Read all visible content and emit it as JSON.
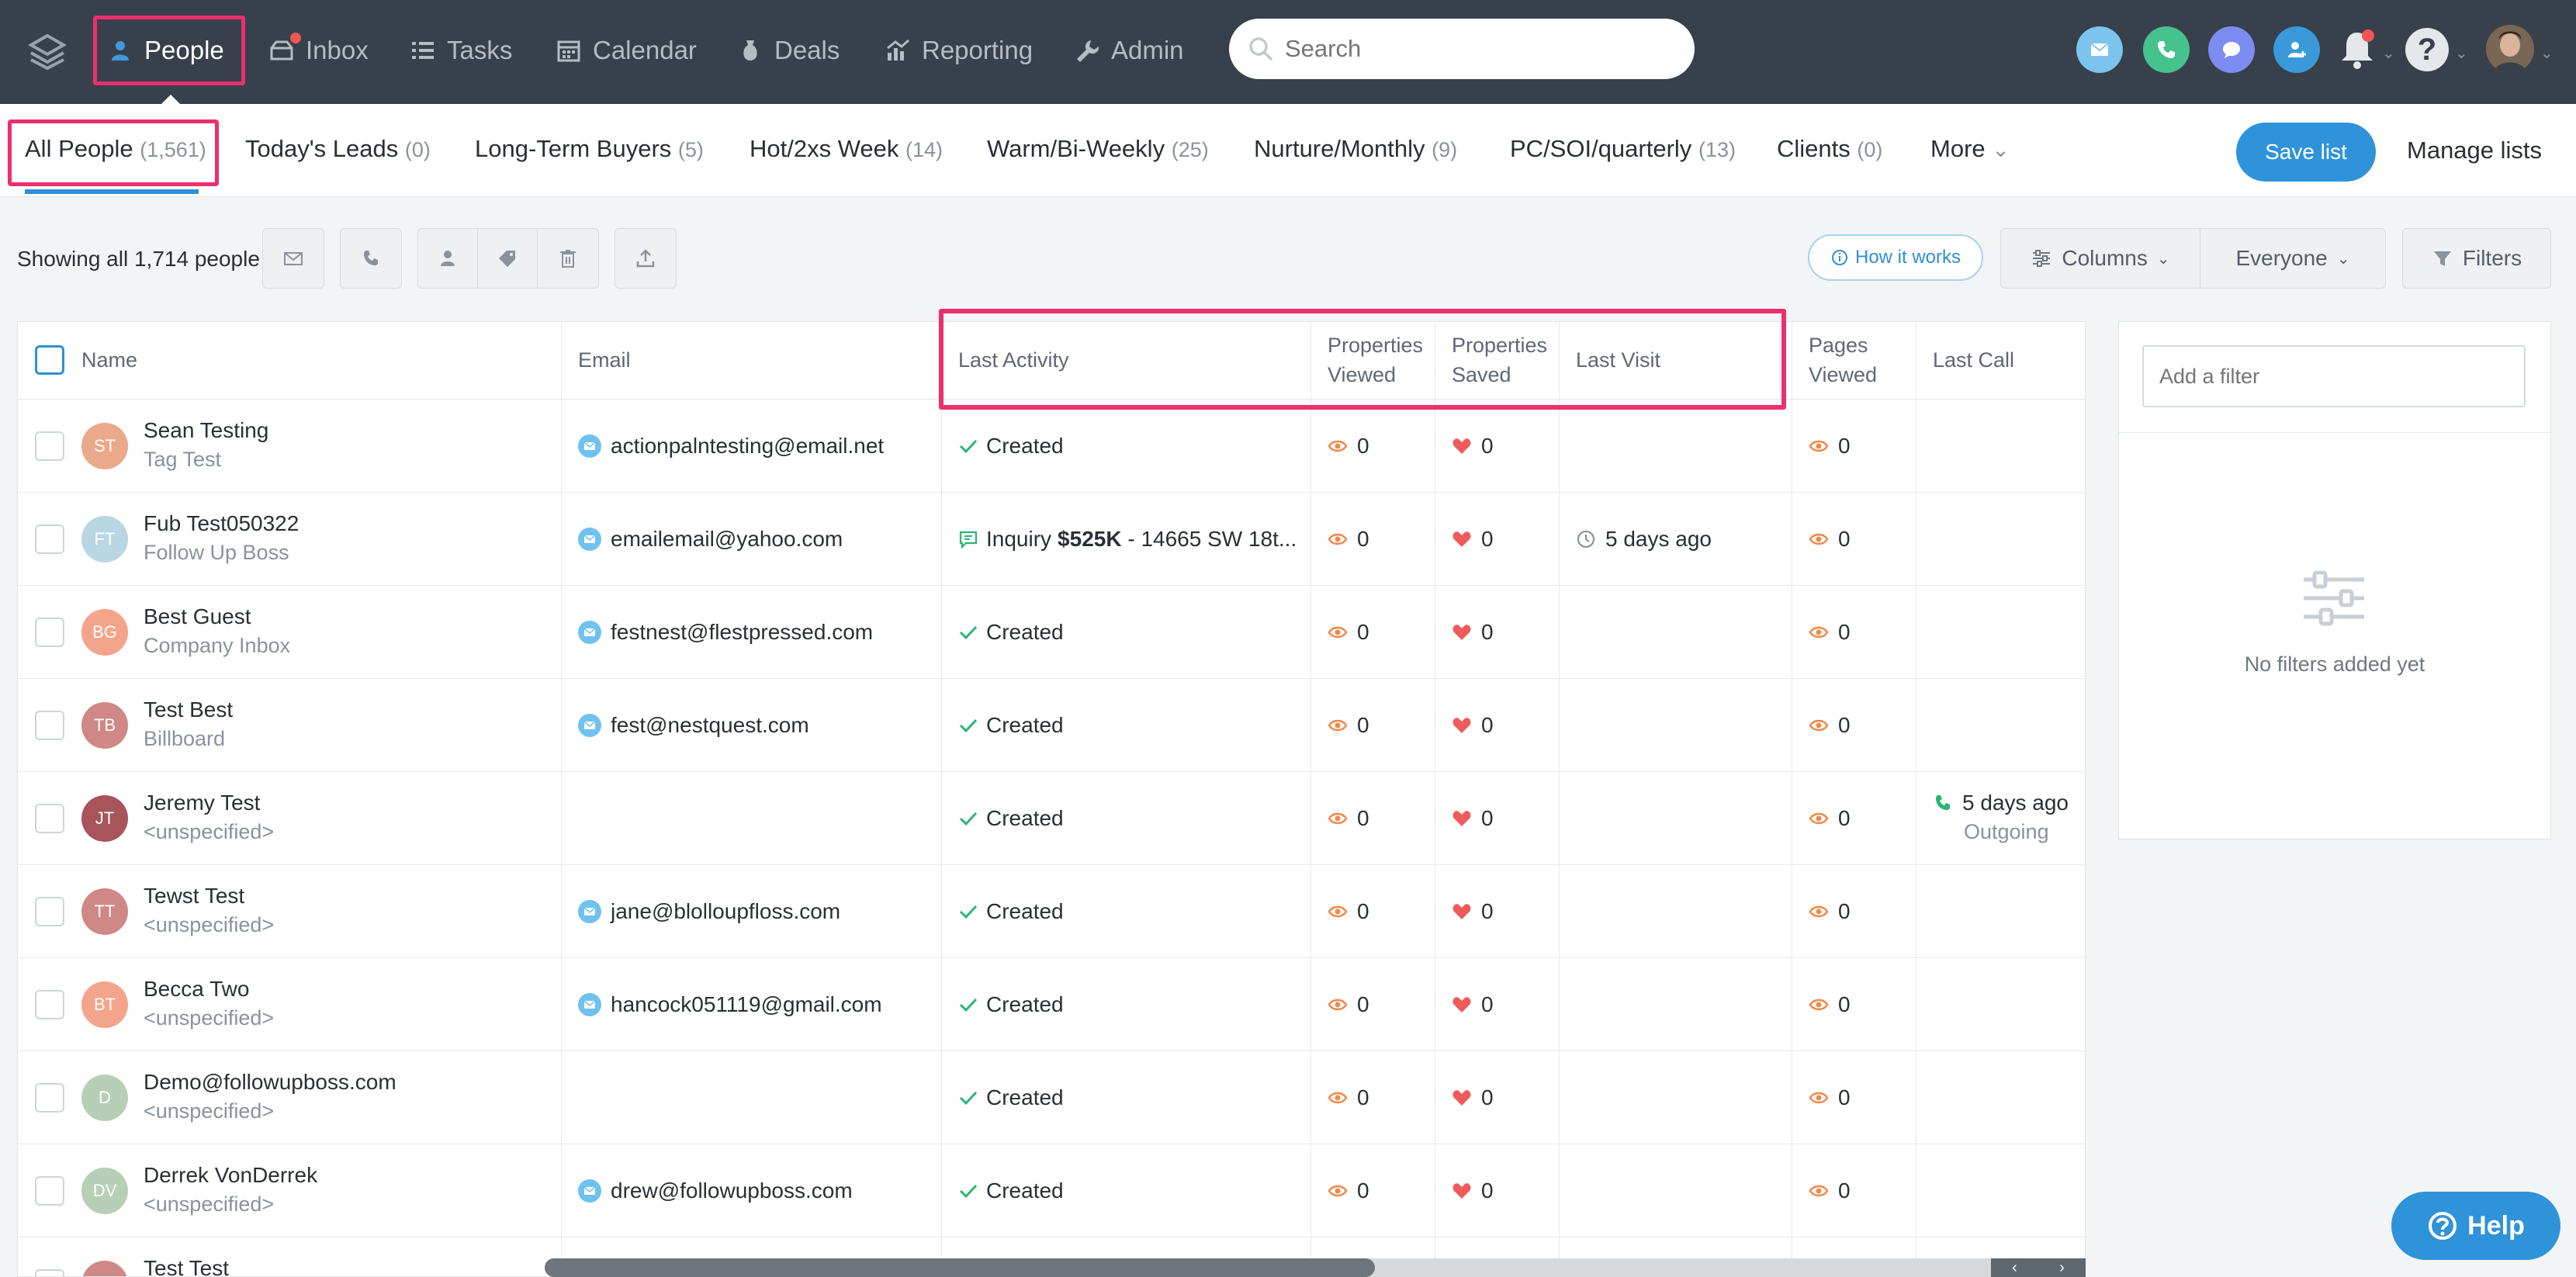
{
  "nav": {
    "items": [
      {
        "label": "People",
        "icon": "person-icon"
      },
      {
        "label": "Inbox",
        "icon": "inbox-icon"
      },
      {
        "label": "Tasks",
        "icon": "tasks-icon"
      },
      {
        "label": "Calendar",
        "icon": "calendar-icon"
      },
      {
        "label": "Deals",
        "icon": "deals-icon"
      },
      {
        "label": "Reporting",
        "icon": "reporting-icon"
      },
      {
        "label": "Admin",
        "icon": "wrench-icon"
      }
    ],
    "search_placeholder": "Search",
    "help_glyph": "?"
  },
  "lists": {
    "tabs": [
      {
        "label": "All People",
        "count": "(1,561)"
      },
      {
        "label": "Today's Leads",
        "count": "(0)"
      },
      {
        "label": "Long-Term Buyers",
        "count": "(5)"
      },
      {
        "label": "Hot/2xs Week",
        "count": "(14)"
      },
      {
        "label": "Warm/Bi-Weekly",
        "count": "(25)"
      },
      {
        "label": "Nurture/Monthly",
        "count": "(9)"
      },
      {
        "label": "PC/SOI/quarterly",
        "count": "(13)"
      },
      {
        "label": "Clients",
        "count": "(0)"
      }
    ],
    "more_label": "More",
    "save_label": "Save list",
    "manage_label": "Manage lists"
  },
  "toolbar": {
    "showing": "Showing all 1,714 people",
    "how_it_works": "How it works",
    "columns_label": "Columns",
    "everyone_label": "Everyone",
    "filters_label": "Filters"
  },
  "table": {
    "headers": {
      "name": "Name",
      "email": "Email",
      "last_activity": "Last Activity",
      "properties_viewed_1": "Properties",
      "properties_viewed_2": "Viewed",
      "properties_saved_1": "Properties",
      "properties_saved_2": "Saved",
      "last_visit": "Last Visit",
      "pages_viewed_1": "Pages",
      "pages_viewed_2": "Viewed",
      "last_call": "Last Call"
    },
    "rows": [
      {
        "initials": "ST",
        "color": "#e9a98a",
        "name": "Sean Testing",
        "source": "Tag Test",
        "email": "actionpalntesting@email.net",
        "activity": "Created",
        "activity_amount": "",
        "pviewed": "0",
        "psaved": "0",
        "last_visit": "",
        "pages": "0",
        "last_call": "",
        "call_dir": ""
      },
      {
        "initials": "FT",
        "color": "#b9d6e3",
        "name": "Fub Test050322",
        "source": "Follow Up Boss",
        "email": "emailemail@yahoo.com",
        "activity": "Inquiry",
        "activity_amount": "$525K",
        "activity_rest": " - 14665 SW 18t...",
        "pviewed": "0",
        "psaved": "0",
        "last_visit": "5 days ago",
        "pages": "0",
        "last_call": "",
        "call_dir": ""
      },
      {
        "initials": "BG",
        "color": "#f5a48c",
        "name": "Best Guest",
        "source": "Company Inbox",
        "email": "festnest@flestpressed.com",
        "activity": "Created",
        "activity_amount": "",
        "pviewed": "0",
        "psaved": "0",
        "last_visit": "",
        "pages": "0",
        "last_call": "",
        "call_dir": ""
      },
      {
        "initials": "TB",
        "color": "#cf8886",
        "name": "Test Best",
        "source": "Billboard",
        "email": "fest@nestquest.com",
        "activity": "Created",
        "activity_amount": "",
        "pviewed": "0",
        "psaved": "0",
        "last_visit": "",
        "pages": "0",
        "last_call": "",
        "call_dir": ""
      },
      {
        "initials": "JT",
        "color": "#a7545b",
        "name": "Jeremy Test",
        "source": "<unspecified>",
        "email": "",
        "activity": "Created",
        "activity_amount": "",
        "pviewed": "0",
        "psaved": "0",
        "last_visit": "",
        "pages": "0",
        "last_call": "5 days ago",
        "call_dir": "Outgoing"
      },
      {
        "initials": "TT",
        "color": "#cf8886",
        "name": "Tewst Test",
        "source": "<unspecified>",
        "email": "jane@blolloupfloss.com",
        "activity": "Created",
        "activity_amount": "",
        "pviewed": "0",
        "psaved": "0",
        "last_visit": "",
        "pages": "0",
        "last_call": "",
        "call_dir": ""
      },
      {
        "initials": "BT",
        "color": "#f5a48c",
        "name": "Becca Two",
        "source": "<unspecified>",
        "email": "hancock051119@gmail.com",
        "activity": "Created",
        "activity_amount": "",
        "pviewed": "0",
        "psaved": "0",
        "last_visit": "",
        "pages": "0",
        "last_call": "",
        "call_dir": ""
      },
      {
        "initials": "D",
        "color": "#b7cfb6",
        "name": "Demo@followupboss.com",
        "source": "<unspecified>",
        "email": "",
        "activity": "Created",
        "activity_amount": "",
        "pviewed": "0",
        "psaved": "0",
        "last_visit": "",
        "pages": "0",
        "last_call": "",
        "call_dir": ""
      },
      {
        "initials": "DV",
        "color": "#b7cfb6",
        "name": "Derrek VonDerrek",
        "source": "<unspecified>",
        "email": "drew@followupboss.com",
        "activity": "Created",
        "activity_amount": "",
        "pviewed": "0",
        "psaved": "0",
        "last_visit": "",
        "pages": "0",
        "last_call": "",
        "call_dir": ""
      },
      {
        "initials": "",
        "color": "#cf8886",
        "name": "Test Test",
        "source": "",
        "email": "",
        "activity": "",
        "activity_amount": "",
        "pviewed": "",
        "psaved": "",
        "last_visit": "",
        "pages": "",
        "last_call": "",
        "call_dir": ""
      }
    ]
  },
  "filter_panel": {
    "placeholder": "Add a filter",
    "empty_text": "No filters added yet"
  },
  "help_button": "Help",
  "colors": {
    "nav_bg": "#37404b",
    "highlight": "#ee2f6c",
    "accent_blue": "#2f93da",
    "eye_orange": "#f08a4b",
    "heart_red": "#ef5b5b",
    "check_green": "#2bb673"
  }
}
